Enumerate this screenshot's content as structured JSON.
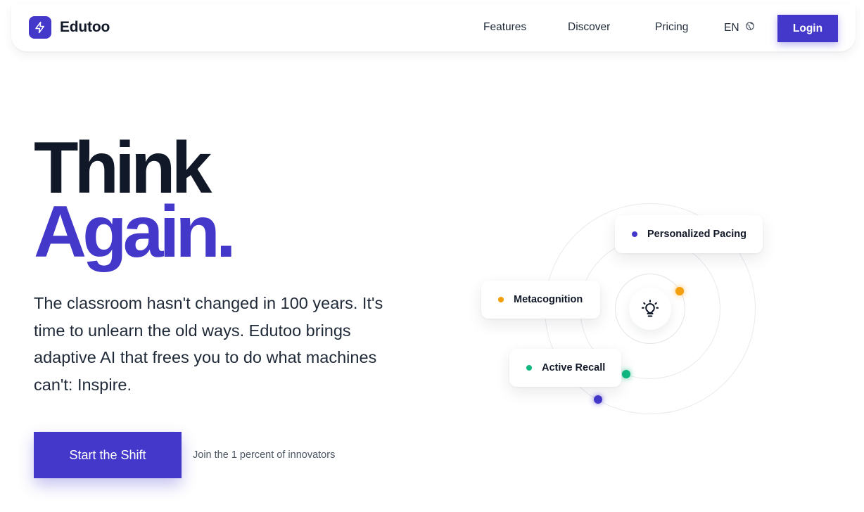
{
  "brand": {
    "name": "Edutoo",
    "accent": "#4338ca"
  },
  "nav": {
    "features": "Features",
    "discover": "Discover",
    "pricing": "Pricing",
    "lang": "EN",
    "login": "Login"
  },
  "hero": {
    "line1": "Think",
    "line2": "Again.",
    "subtitle": "The classroom hasn't changed in 100 years. It's time to unlearn the old ways. Edutoo brings adaptive AI that frees you to do what machines can't: Inspire.",
    "cta": "Start the Shift",
    "cta_note": "Join the 1 percent of innovators"
  },
  "diagram": {
    "center_icon": "lightbulb-icon",
    "pills": [
      {
        "label": "Personalized Pacing",
        "color": "#4338ca"
      },
      {
        "label": "Metacognition",
        "color": "#f59e0b"
      },
      {
        "label": "Active Recall",
        "color": "#10b981"
      }
    ],
    "orb_colors": {
      "orange": "#f59e0b",
      "green": "#10b981",
      "blue": "#4338ca"
    }
  }
}
